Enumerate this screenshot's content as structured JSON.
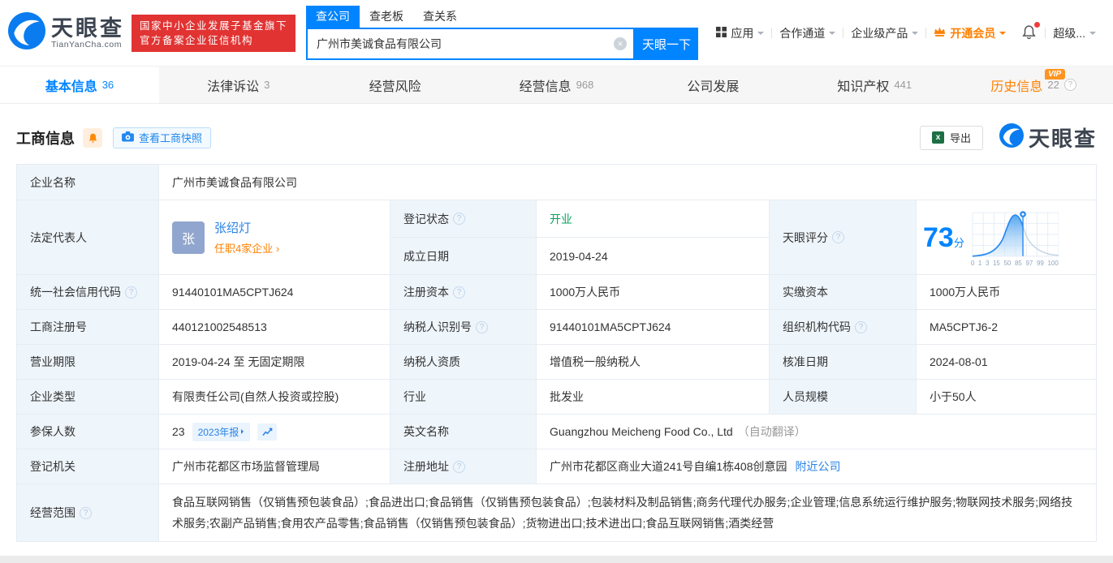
{
  "header": {
    "logo": {
      "title": "天眼查",
      "subtitle": "TianYanCha.com"
    },
    "badge": {
      "line1": "国家中小企业发展子基金旗下",
      "line2": "官方备案企业征信机构"
    },
    "search": {
      "tabs": {
        "company": "查公司",
        "boss": "查老板",
        "relation": "查关系"
      },
      "value": "广州市美诚食品有限公司",
      "button": "天眼一下"
    },
    "nav": {
      "apps": "应用",
      "partner": "合作通道",
      "enterprise": "企业级产品",
      "vip": "开通会员",
      "super": "超级..."
    }
  },
  "tabs": {
    "basic": {
      "label": "基本信息",
      "count": "36"
    },
    "legal": {
      "label": "法律诉讼",
      "count": "3"
    },
    "risk": {
      "label": "经营风险",
      "count": ""
    },
    "operation": {
      "label": "经营信息",
      "count": "968"
    },
    "development": {
      "label": "公司发展",
      "count": ""
    },
    "ip": {
      "label": "知识产权",
      "count": "441"
    },
    "history": {
      "label": "历史信息",
      "count": "22",
      "vip": "VIP"
    }
  },
  "section": {
    "title": "工商信息",
    "snapshot": "查看工商快照",
    "export": "导出",
    "watermark": "天眼查"
  },
  "info": {
    "company_name": {
      "label": "企业名称",
      "value": "广州市美诚食品有限公司"
    },
    "legal_rep": {
      "label": "法定代表人",
      "avatar": "张",
      "name": "张绍灯",
      "link": "任职4家企业 ›"
    },
    "reg_status": {
      "label": "登记状态",
      "value": "开业"
    },
    "establish_date": {
      "label": "成立日期",
      "value": "2019-04-24"
    },
    "score": {
      "label": "天眼评分",
      "value": "73",
      "unit": "分"
    },
    "credit_code": {
      "label": "统一社会信用代码",
      "value": "91440101MA5CPTJ624"
    },
    "reg_capital": {
      "label": "注册资本",
      "value": "1000万人民币"
    },
    "paid_capital": {
      "label": "实缴资本",
      "value": "1000万人民币"
    },
    "reg_number": {
      "label": "工商注册号",
      "value": "440121002548513"
    },
    "taxpayer_id": {
      "label": "纳税人识别号",
      "value": "91440101MA5CPTJ624"
    },
    "org_code": {
      "label": "组织机构代码",
      "value": "MA5CPTJ6-2"
    },
    "business_term": {
      "label": "营业期限",
      "value": "2019-04-24 至 无固定期限"
    },
    "taxpayer_quality": {
      "label": "纳税人资质",
      "value": "增值税一般纳税人"
    },
    "approval_date": {
      "label": "核准日期",
      "value": "2024-08-01"
    },
    "company_type": {
      "label": "企业类型",
      "value": "有限责任公司(自然人投资或控股)"
    },
    "industry": {
      "label": "行业",
      "value": "批发业"
    },
    "staff_size": {
      "label": "人员规模",
      "value": "小于50人"
    },
    "insured_count": {
      "label": "参保人数",
      "value": "23",
      "badge": "2023年报"
    },
    "english_name": {
      "label": "英文名称",
      "value": "Guangzhou Meicheng Food Co., Ltd",
      "note": "（自动翻译）"
    },
    "reg_authority": {
      "label": "登记机关",
      "value": "广州市花都区市场监督管理局"
    },
    "reg_address": {
      "label": "注册地址",
      "value": "广州市花都区商业大道241号自编1栋408创意园",
      "link": "附近公司"
    },
    "business_scope": {
      "label": "经营范围",
      "value": "食品互联网销售（仅销售预包装食品）;食品进出口;食品销售（仅销售预包装食品）;包装材料及制品销售;商务代理代办服务;企业管理;信息系统运行维护服务;物联网技术服务;网络技术服务;农副产品销售;食用农产品零售;食品销售（仅销售预包装食品）;货物进出口;技术进出口;食品互联网销售;酒类经营"
    }
  },
  "chart_data": {
    "type": "area",
    "title": "天眼评分",
    "score": 73,
    "x_ticks": [
      "0",
      "1",
      "3",
      "15",
      "50",
      "85",
      "97",
      "99",
      "100"
    ],
    "marker_color": "#2a8af0",
    "curve_color": "#2a8af0"
  }
}
